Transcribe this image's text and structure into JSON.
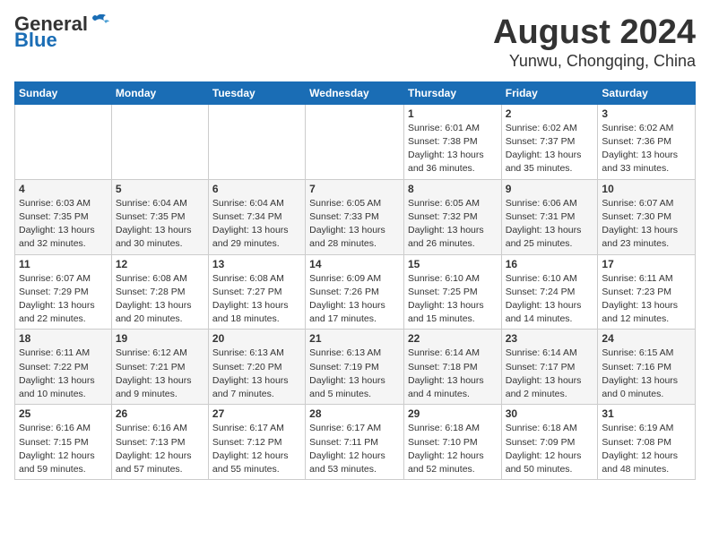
{
  "header": {
    "logo_general": "General",
    "logo_blue": "Blue",
    "month_year": "August 2024",
    "location": "Yunwu, Chongqing, China"
  },
  "weekdays": [
    "Sunday",
    "Monday",
    "Tuesday",
    "Wednesday",
    "Thursday",
    "Friday",
    "Saturday"
  ],
  "weeks": [
    [
      {
        "day": "",
        "info": ""
      },
      {
        "day": "",
        "info": ""
      },
      {
        "day": "",
        "info": ""
      },
      {
        "day": "",
        "info": ""
      },
      {
        "day": "1",
        "info": "Sunrise: 6:01 AM\nSunset: 7:38 PM\nDaylight: 13 hours\nand 36 minutes."
      },
      {
        "day": "2",
        "info": "Sunrise: 6:02 AM\nSunset: 7:37 PM\nDaylight: 13 hours\nand 35 minutes."
      },
      {
        "day": "3",
        "info": "Sunrise: 6:02 AM\nSunset: 7:36 PM\nDaylight: 13 hours\nand 33 minutes."
      }
    ],
    [
      {
        "day": "4",
        "info": "Sunrise: 6:03 AM\nSunset: 7:35 PM\nDaylight: 13 hours\nand 32 minutes."
      },
      {
        "day": "5",
        "info": "Sunrise: 6:04 AM\nSunset: 7:35 PM\nDaylight: 13 hours\nand 30 minutes."
      },
      {
        "day": "6",
        "info": "Sunrise: 6:04 AM\nSunset: 7:34 PM\nDaylight: 13 hours\nand 29 minutes."
      },
      {
        "day": "7",
        "info": "Sunrise: 6:05 AM\nSunset: 7:33 PM\nDaylight: 13 hours\nand 28 minutes."
      },
      {
        "day": "8",
        "info": "Sunrise: 6:05 AM\nSunset: 7:32 PM\nDaylight: 13 hours\nand 26 minutes."
      },
      {
        "day": "9",
        "info": "Sunrise: 6:06 AM\nSunset: 7:31 PM\nDaylight: 13 hours\nand 25 minutes."
      },
      {
        "day": "10",
        "info": "Sunrise: 6:07 AM\nSunset: 7:30 PM\nDaylight: 13 hours\nand 23 minutes."
      }
    ],
    [
      {
        "day": "11",
        "info": "Sunrise: 6:07 AM\nSunset: 7:29 PM\nDaylight: 13 hours\nand 22 minutes."
      },
      {
        "day": "12",
        "info": "Sunrise: 6:08 AM\nSunset: 7:28 PM\nDaylight: 13 hours\nand 20 minutes."
      },
      {
        "day": "13",
        "info": "Sunrise: 6:08 AM\nSunset: 7:27 PM\nDaylight: 13 hours\nand 18 minutes."
      },
      {
        "day": "14",
        "info": "Sunrise: 6:09 AM\nSunset: 7:26 PM\nDaylight: 13 hours\nand 17 minutes."
      },
      {
        "day": "15",
        "info": "Sunrise: 6:10 AM\nSunset: 7:25 PM\nDaylight: 13 hours\nand 15 minutes."
      },
      {
        "day": "16",
        "info": "Sunrise: 6:10 AM\nSunset: 7:24 PM\nDaylight: 13 hours\nand 14 minutes."
      },
      {
        "day": "17",
        "info": "Sunrise: 6:11 AM\nSunset: 7:23 PM\nDaylight: 13 hours\nand 12 minutes."
      }
    ],
    [
      {
        "day": "18",
        "info": "Sunrise: 6:11 AM\nSunset: 7:22 PM\nDaylight: 13 hours\nand 10 minutes."
      },
      {
        "day": "19",
        "info": "Sunrise: 6:12 AM\nSunset: 7:21 PM\nDaylight: 13 hours\nand 9 minutes."
      },
      {
        "day": "20",
        "info": "Sunrise: 6:13 AM\nSunset: 7:20 PM\nDaylight: 13 hours\nand 7 minutes."
      },
      {
        "day": "21",
        "info": "Sunrise: 6:13 AM\nSunset: 7:19 PM\nDaylight: 13 hours\nand 5 minutes."
      },
      {
        "day": "22",
        "info": "Sunrise: 6:14 AM\nSunset: 7:18 PM\nDaylight: 13 hours\nand 4 minutes."
      },
      {
        "day": "23",
        "info": "Sunrise: 6:14 AM\nSunset: 7:17 PM\nDaylight: 13 hours\nand 2 minutes."
      },
      {
        "day": "24",
        "info": "Sunrise: 6:15 AM\nSunset: 7:16 PM\nDaylight: 13 hours\nand 0 minutes."
      }
    ],
    [
      {
        "day": "25",
        "info": "Sunrise: 6:16 AM\nSunset: 7:15 PM\nDaylight: 12 hours\nand 59 minutes."
      },
      {
        "day": "26",
        "info": "Sunrise: 6:16 AM\nSunset: 7:13 PM\nDaylight: 12 hours\nand 57 minutes."
      },
      {
        "day": "27",
        "info": "Sunrise: 6:17 AM\nSunset: 7:12 PM\nDaylight: 12 hours\nand 55 minutes."
      },
      {
        "day": "28",
        "info": "Sunrise: 6:17 AM\nSunset: 7:11 PM\nDaylight: 12 hours\nand 53 minutes."
      },
      {
        "day": "29",
        "info": "Sunrise: 6:18 AM\nSunset: 7:10 PM\nDaylight: 12 hours\nand 52 minutes."
      },
      {
        "day": "30",
        "info": "Sunrise: 6:18 AM\nSunset: 7:09 PM\nDaylight: 12 hours\nand 50 minutes."
      },
      {
        "day": "31",
        "info": "Sunrise: 6:19 AM\nSunset: 7:08 PM\nDaylight: 12 hours\nand 48 minutes."
      }
    ]
  ]
}
